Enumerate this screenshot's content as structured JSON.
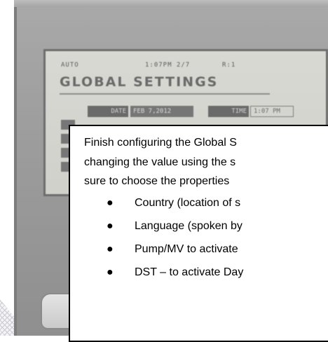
{
  "lcd": {
    "status_mode": "AUTO",
    "status_time": "1:07PM 2/7",
    "status_r": "R:1",
    "title": "GLOBAL SETTINGS",
    "date_label": "DATE",
    "date_value": "FEB 7,2012",
    "time_label": "TIME",
    "time_value": "1:07 PM"
  },
  "callout": {
    "lines": [
      "Finish configuring the Global S",
      "changing the value using the s",
      "sure to choose the properties"
    ],
    "bullets": [
      "Country (location of s",
      "Language (spoken by",
      "Pump/MV to activate",
      "DST – to activate Day"
    ]
  }
}
